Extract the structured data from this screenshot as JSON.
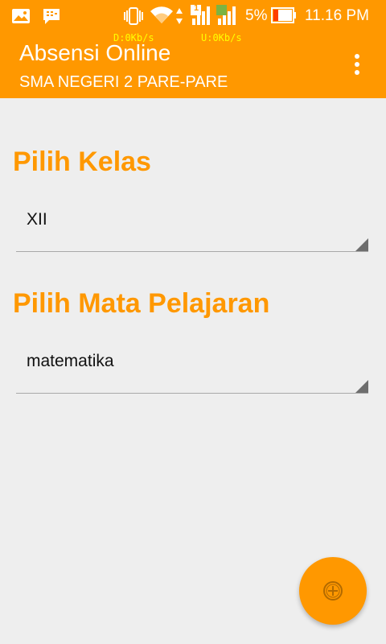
{
  "status_bar": {
    "battery_percent": "5%",
    "time": "11.16 PM",
    "download_speed": "D:0Kb/s",
    "upload_speed": "U:0Kb/s",
    "sim_slot": "1",
    "icons": [
      "gallery-icon",
      "bbm-icon",
      "vibrate-icon",
      "wifi-icon",
      "signal-icon",
      "battery-icon"
    ]
  },
  "app_bar": {
    "title": "Absensi Online",
    "subtitle": "SMA NEGERI 2 PARE-PARE",
    "menu_icon": "more-vert-icon"
  },
  "form": {
    "class_label": "Pilih Kelas",
    "class_value": "XII",
    "subject_label": "Pilih Mata Pelajaran",
    "subject_value": "matematika"
  },
  "fab": {
    "icon": "add-circle-icon"
  },
  "colors": {
    "primary": "#ff9800",
    "background": "#eeeeee",
    "speed_text": "#ffff00"
  }
}
